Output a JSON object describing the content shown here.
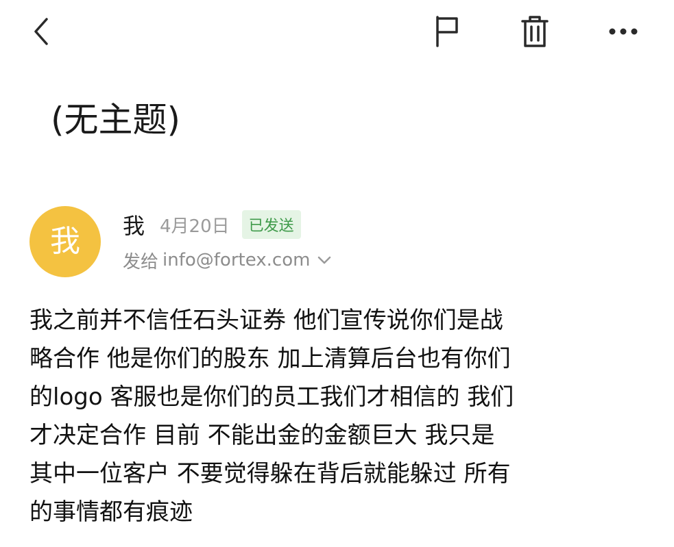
{
  "toolbar": {
    "back_icon": "chevron-left-icon",
    "flag_icon": "flag-icon",
    "delete_icon": "trash-icon",
    "more_icon": "more-horizontal-icon"
  },
  "email": {
    "subject": "(无主题)",
    "avatar_text": "我",
    "avatar_color": "#f4c241",
    "sender": "我",
    "date": "4月20日",
    "status_badge": "已发送",
    "status_color": "#3f9a4a",
    "recipient_prefix": "发给",
    "recipient": "info@fortex.com",
    "body_lines": [
      "我之前并不信任石头证券 他们宣传说你们是战",
      "略合作 他是你们的股东 加上清算后台也有你们",
      "的logo 客服也是你们的员工我们才相信的  我们",
      "才决定合作 目前 不能出金的金额巨大  我只是",
      "其中一位客户 不要觉得躲在背后就能躲过 所有",
      "的事情都有痕迹"
    ]
  }
}
